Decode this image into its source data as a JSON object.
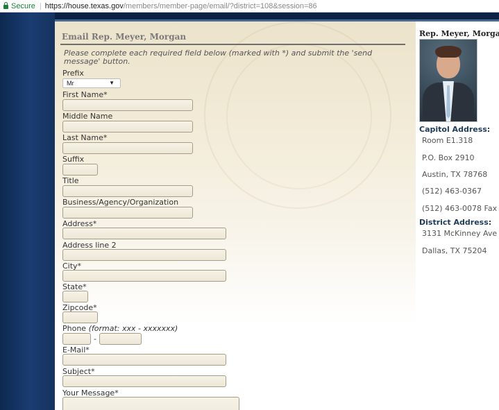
{
  "browser": {
    "secure_label": "Secure",
    "separator": "|",
    "url_host": "https://house.texas.gov",
    "url_path": "/members/member-page/email/?district=108&session=86"
  },
  "form": {
    "heading": "Email Rep. Meyer, Morgan",
    "instructions": "Please complete each required field below (marked with *) and submit the 'send message' button.",
    "prefix_label": "Prefix",
    "prefix_value": "Mr",
    "first_name_label": "First Name*",
    "middle_name_label": "Middle Name",
    "last_name_label": "Last Name*",
    "suffix_label": "Suffix",
    "title_label": "Title",
    "business_label": "Business/Agency/Organization",
    "address_label": "Address*",
    "address2_label": "Address line 2",
    "city_label": "City*",
    "state_label": "State*",
    "zipcode_label": "Zipcode*",
    "phone_label": "Phone",
    "phone_hint": "(format: xxx - xxxxxxx)",
    "phone_dash": "-",
    "email_label": "E-Mail*",
    "subject_label": "Subject*",
    "message_label": "Your Message*"
  },
  "sidebar": {
    "rep_name": "Rep. Meyer, Morgan",
    "capitol_heading": "Capitol Address:",
    "capitol_room": "Room E1.318",
    "capitol_box": "P.O. Box 2910",
    "capitol_city": "Austin, TX 78768",
    "capitol_phone": "(512) 463-0367",
    "capitol_fax": "(512) 463-0078 Fax",
    "district_heading": "District Address:",
    "district_street": "3131 McKinney Ave",
    "district_city": "Dallas, TX 75204"
  },
  "colors": {
    "navy": "#0b2245",
    "parchment": "#ece3cb",
    "secure_green": "#1a7f37",
    "sidebar_heading": "#1f3b5a"
  }
}
